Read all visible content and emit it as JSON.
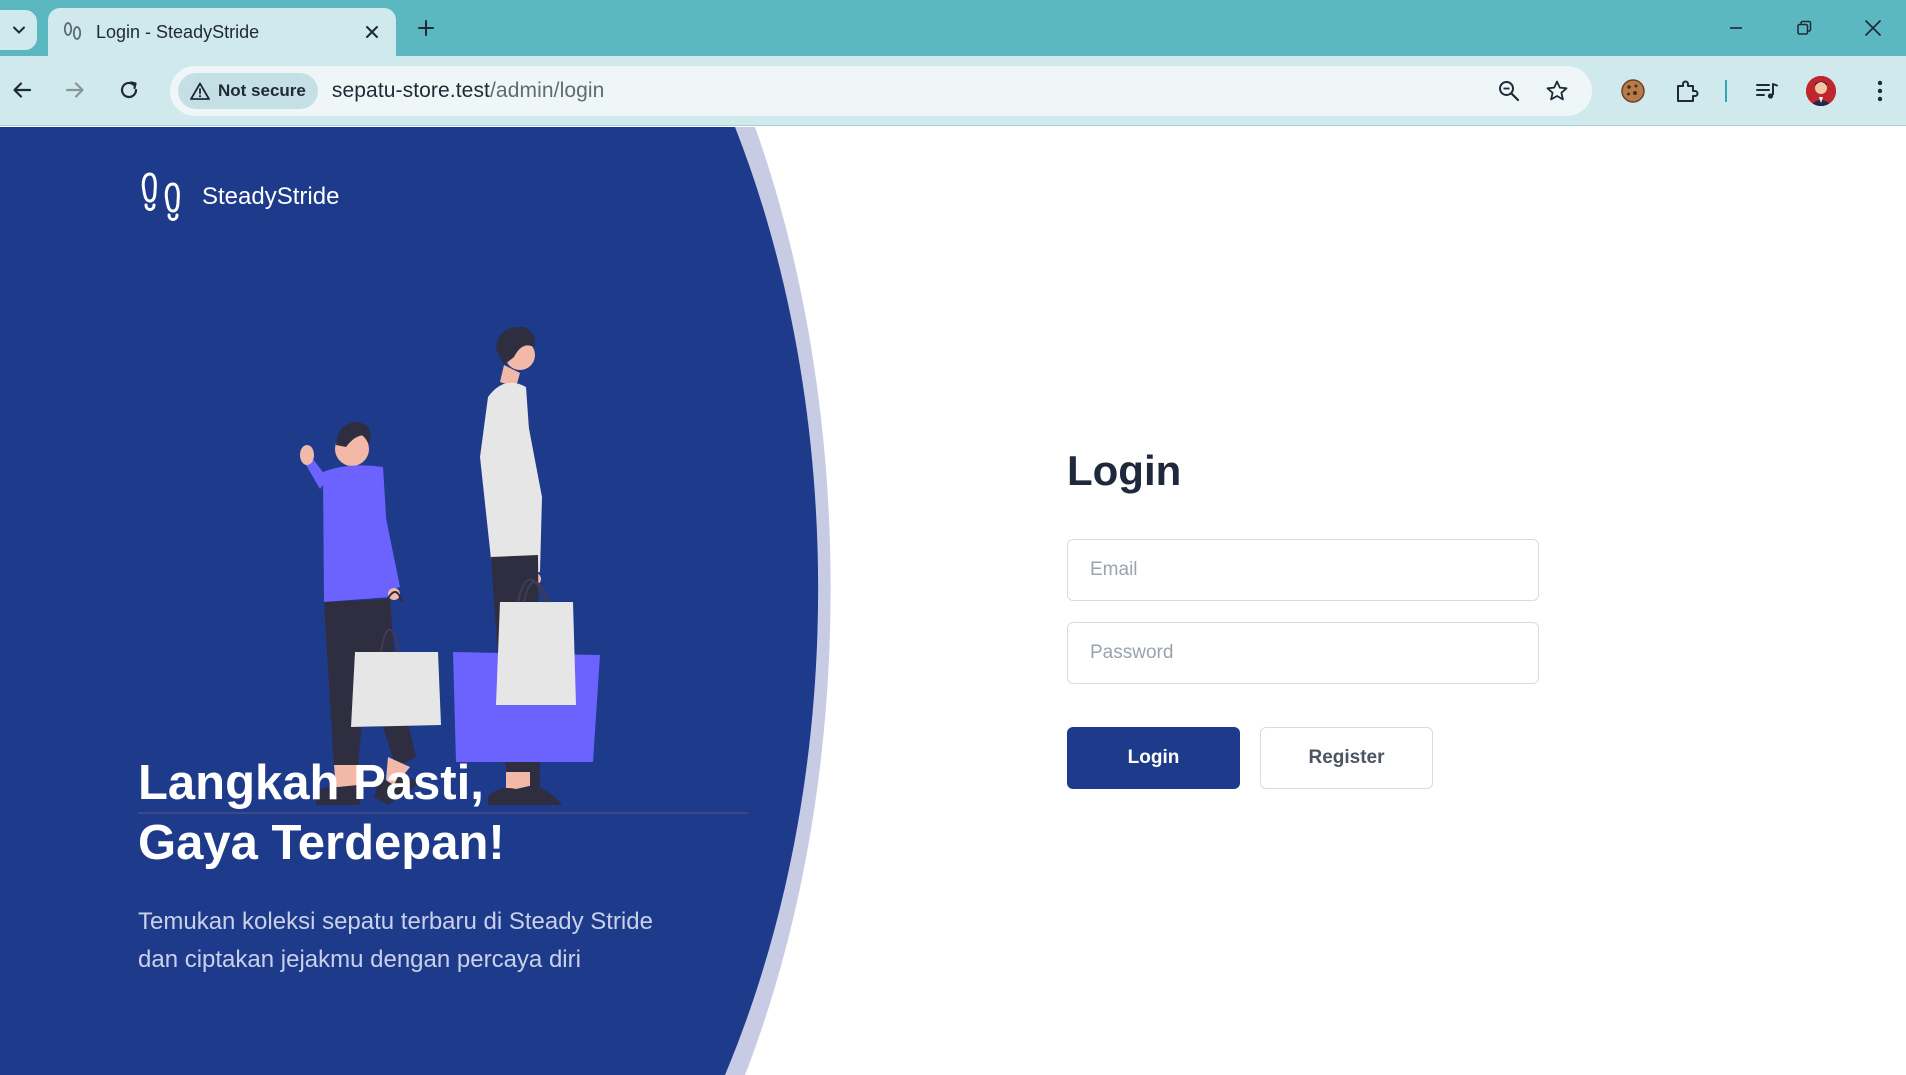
{
  "browser": {
    "tab": {
      "title": "Login - SteadyStride"
    },
    "address": {
      "security_label": "Not secure",
      "url_host": "sepatu-store.test",
      "url_path": "/admin/login"
    },
    "icons": [
      "tab-search-icon",
      "footprint-favicon-icon",
      "close-icon",
      "plus-icon",
      "minimize-icon",
      "restore-icon",
      "window-close-icon",
      "back-arrow-icon",
      "forward-arrow-icon",
      "reload-icon",
      "warning-icon",
      "zoom-icon",
      "star-icon",
      "cookie-icon",
      "puzzle-icon",
      "media-icon",
      "profile-avatar",
      "kebab-menu-icon"
    ]
  },
  "brand": {
    "name": "SteadyStride"
  },
  "hero": {
    "title_line1": "Langkah Pasti,",
    "title_line2": "Gaya Terdepan!",
    "subtitle_line1": "Temukan koleksi sepatu terbaru di Steady Stride",
    "subtitle_line2": "dan ciptakan jejakmu dengan percaya diri"
  },
  "login": {
    "title": "Login",
    "email": {
      "placeholder": "Email",
      "value": ""
    },
    "password": {
      "placeholder": "Password",
      "value": ""
    },
    "login_button": "Login",
    "register_button": "Register"
  },
  "colors": {
    "tabstrip": "#5bb8c1",
    "toolbar": "#cfe9ec",
    "hero_primary": "#1e3a8a",
    "hero_accent": "#c7cbe4",
    "button_primary": "#1e3a8a",
    "illustration_purple": "#6c63ff"
  }
}
